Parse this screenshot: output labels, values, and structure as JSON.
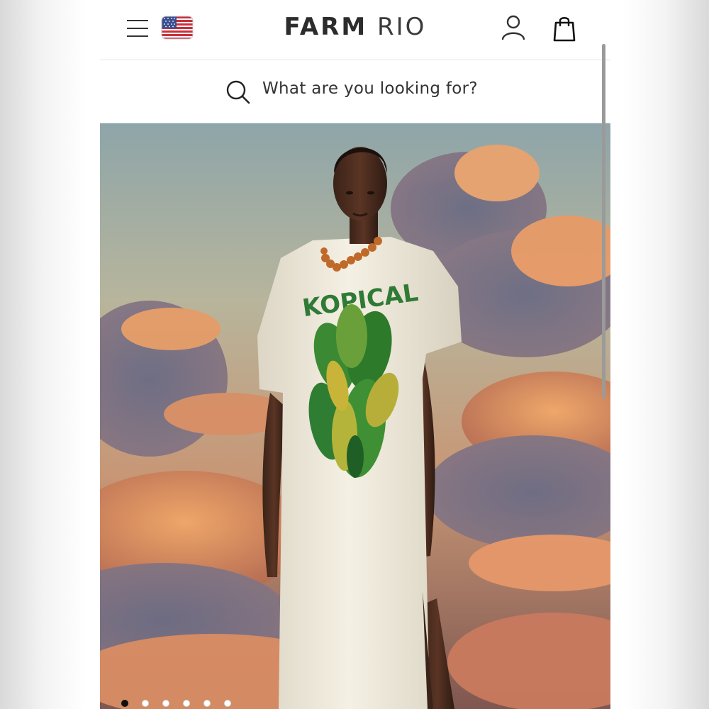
{
  "header": {
    "menu_icon": "hamburger-menu-icon",
    "flag_icon": "us-flag-icon",
    "logo_bold": "FARM",
    "logo_light": "RIO",
    "account_icon": "user-icon",
    "bag_icon": "shopping-bag-icon"
  },
  "search": {
    "icon": "search-icon",
    "placeholder": "What are you looking for?"
  },
  "hero": {
    "shirt_print_text": "KOPICAL",
    "carousel_total": 6,
    "carousel_active": 1
  },
  "colors": {
    "text": "#2c2c2c",
    "print_green": "#2f7a35",
    "dress": "#f3efe2"
  }
}
